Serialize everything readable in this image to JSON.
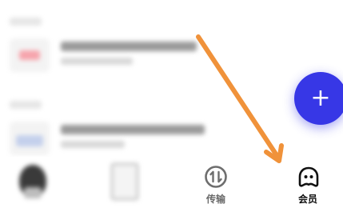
{
  "fab": {
    "symbol": "+"
  },
  "bottom_nav": {
    "items": [
      {
        "label": "",
        "icon": "avatar-icon"
      },
      {
        "label": "",
        "icon": "document-icon"
      },
      {
        "label": "传输",
        "icon": "transfer-icon"
      },
      {
        "label": "会员",
        "icon": "membership-icon"
      }
    ]
  },
  "colors": {
    "fab": "#3737e6",
    "arrow": "#f0923a",
    "label_active": "#111111",
    "label_dim": "#6a6a6a"
  },
  "annotation": {
    "icon": "arrow-annotation-icon"
  }
}
